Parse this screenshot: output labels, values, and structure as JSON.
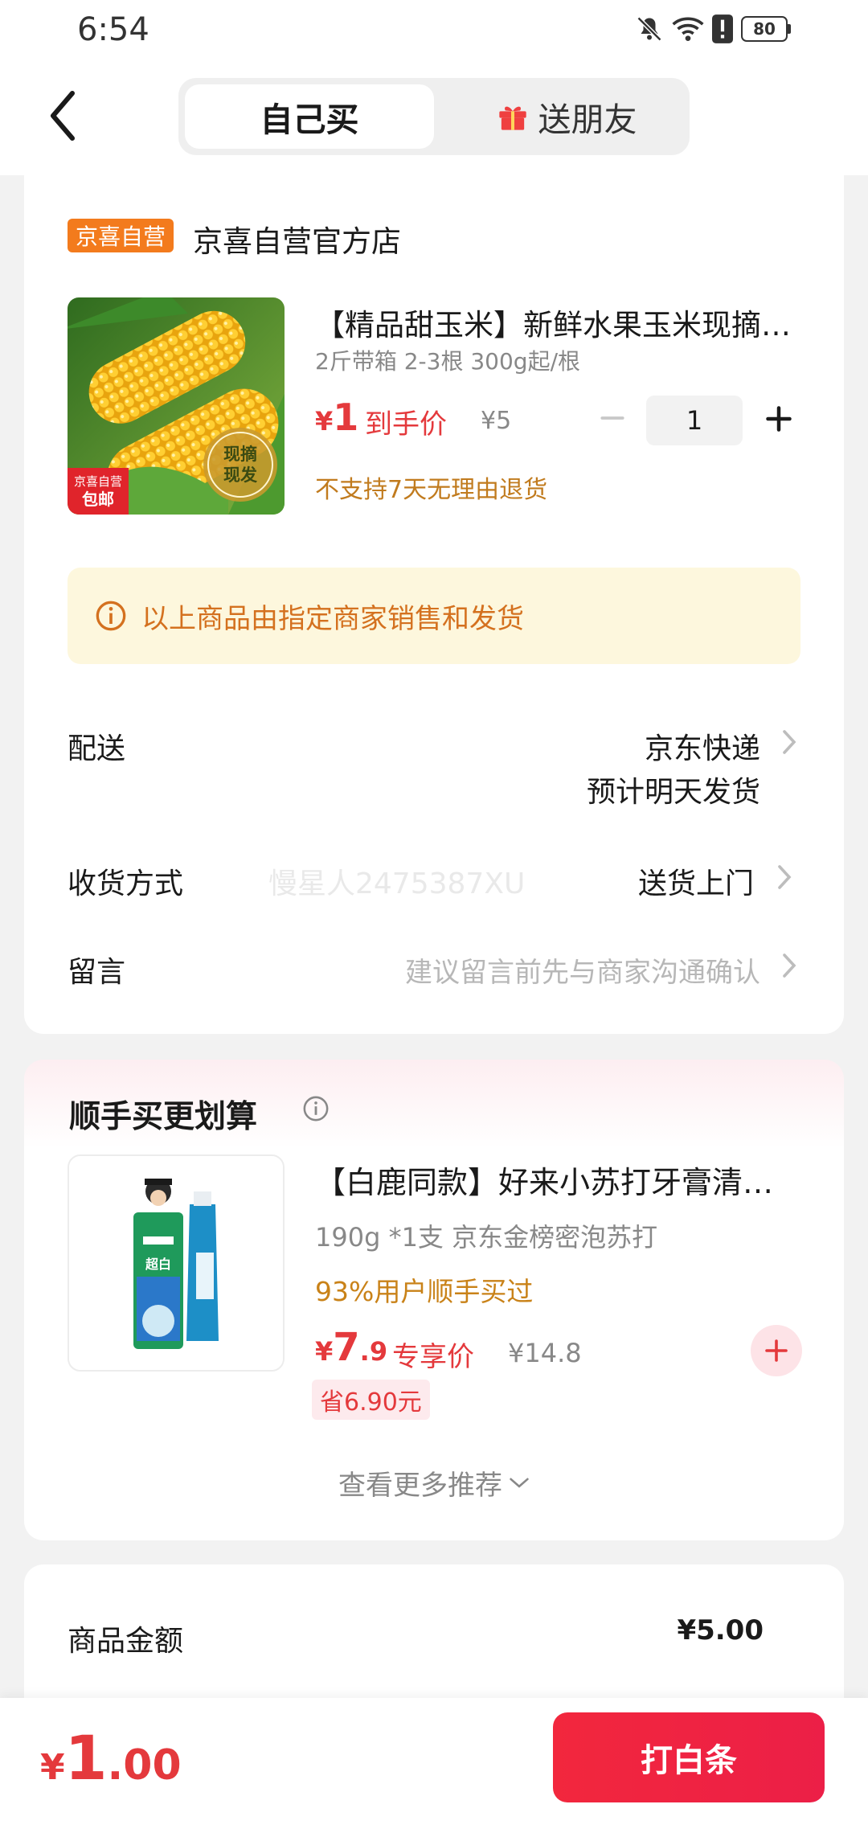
{
  "status_bar": {
    "time": "6:54",
    "battery": "80",
    "icons": [
      "bell-off-icon",
      "wifi-icon",
      "alert-icon",
      "battery-icon"
    ]
  },
  "header": {
    "tabs": [
      {
        "label": "自己买",
        "selected": true
      },
      {
        "label": "送朋友",
        "selected": false,
        "icon": "gift-icon"
      }
    ]
  },
  "store": {
    "badge": "京喜自营",
    "name": "京喜自营官方店"
  },
  "product": {
    "title": "【精品甜玉米】新鲜水果玉米现摘现发",
    "spec": "2斤带箱 2-3根 300g起/根",
    "price_symbol": "¥",
    "price": "1",
    "price_label": "到手价",
    "original_price": "¥5",
    "quantity": "1",
    "no_return": "不支持7天无理由退货",
    "image_badge": "现摘\n现发",
    "image_tag_top": "京喜自营",
    "image_tag_bottom": "包邮"
  },
  "notice": "以上商品由指定商家销售和发货",
  "delivery": {
    "label": "配送",
    "value_line1": "京东快递",
    "value_line2": "预计明天发货"
  },
  "receive": {
    "label": "收货方式",
    "watermark": "慢星人2475387XU",
    "value": "送货上门"
  },
  "message": {
    "label": "留言",
    "placeholder": "建议留言前先与商家沟通确认"
  },
  "recommend": {
    "title": "顺手买更划算",
    "item": {
      "title": "【白鹿同款】好来小苏打牙膏清新口气",
      "spec": "190g *1支 京东金榜密泡苏打",
      "bought": "93%用户顺手买过",
      "price_symbol": "¥",
      "price_int": "7",
      "price_dec": ".9",
      "price_label": "专享价",
      "original_price": "¥14.8",
      "save": "省6.90元"
    },
    "more": "查看更多推荐"
  },
  "summary": {
    "goods_label": "商品金额",
    "goods_value": "¥5.00"
  },
  "bottom": {
    "total_symbol": "¥",
    "total_int": "1",
    "total_dec": ".00",
    "pay_button": "打白条"
  },
  "colors": {
    "accent_red": "#e4393c",
    "store_badge": "#f37b1d",
    "notice_bg": "#fdf7dd",
    "notice_text": "#d4711f"
  }
}
